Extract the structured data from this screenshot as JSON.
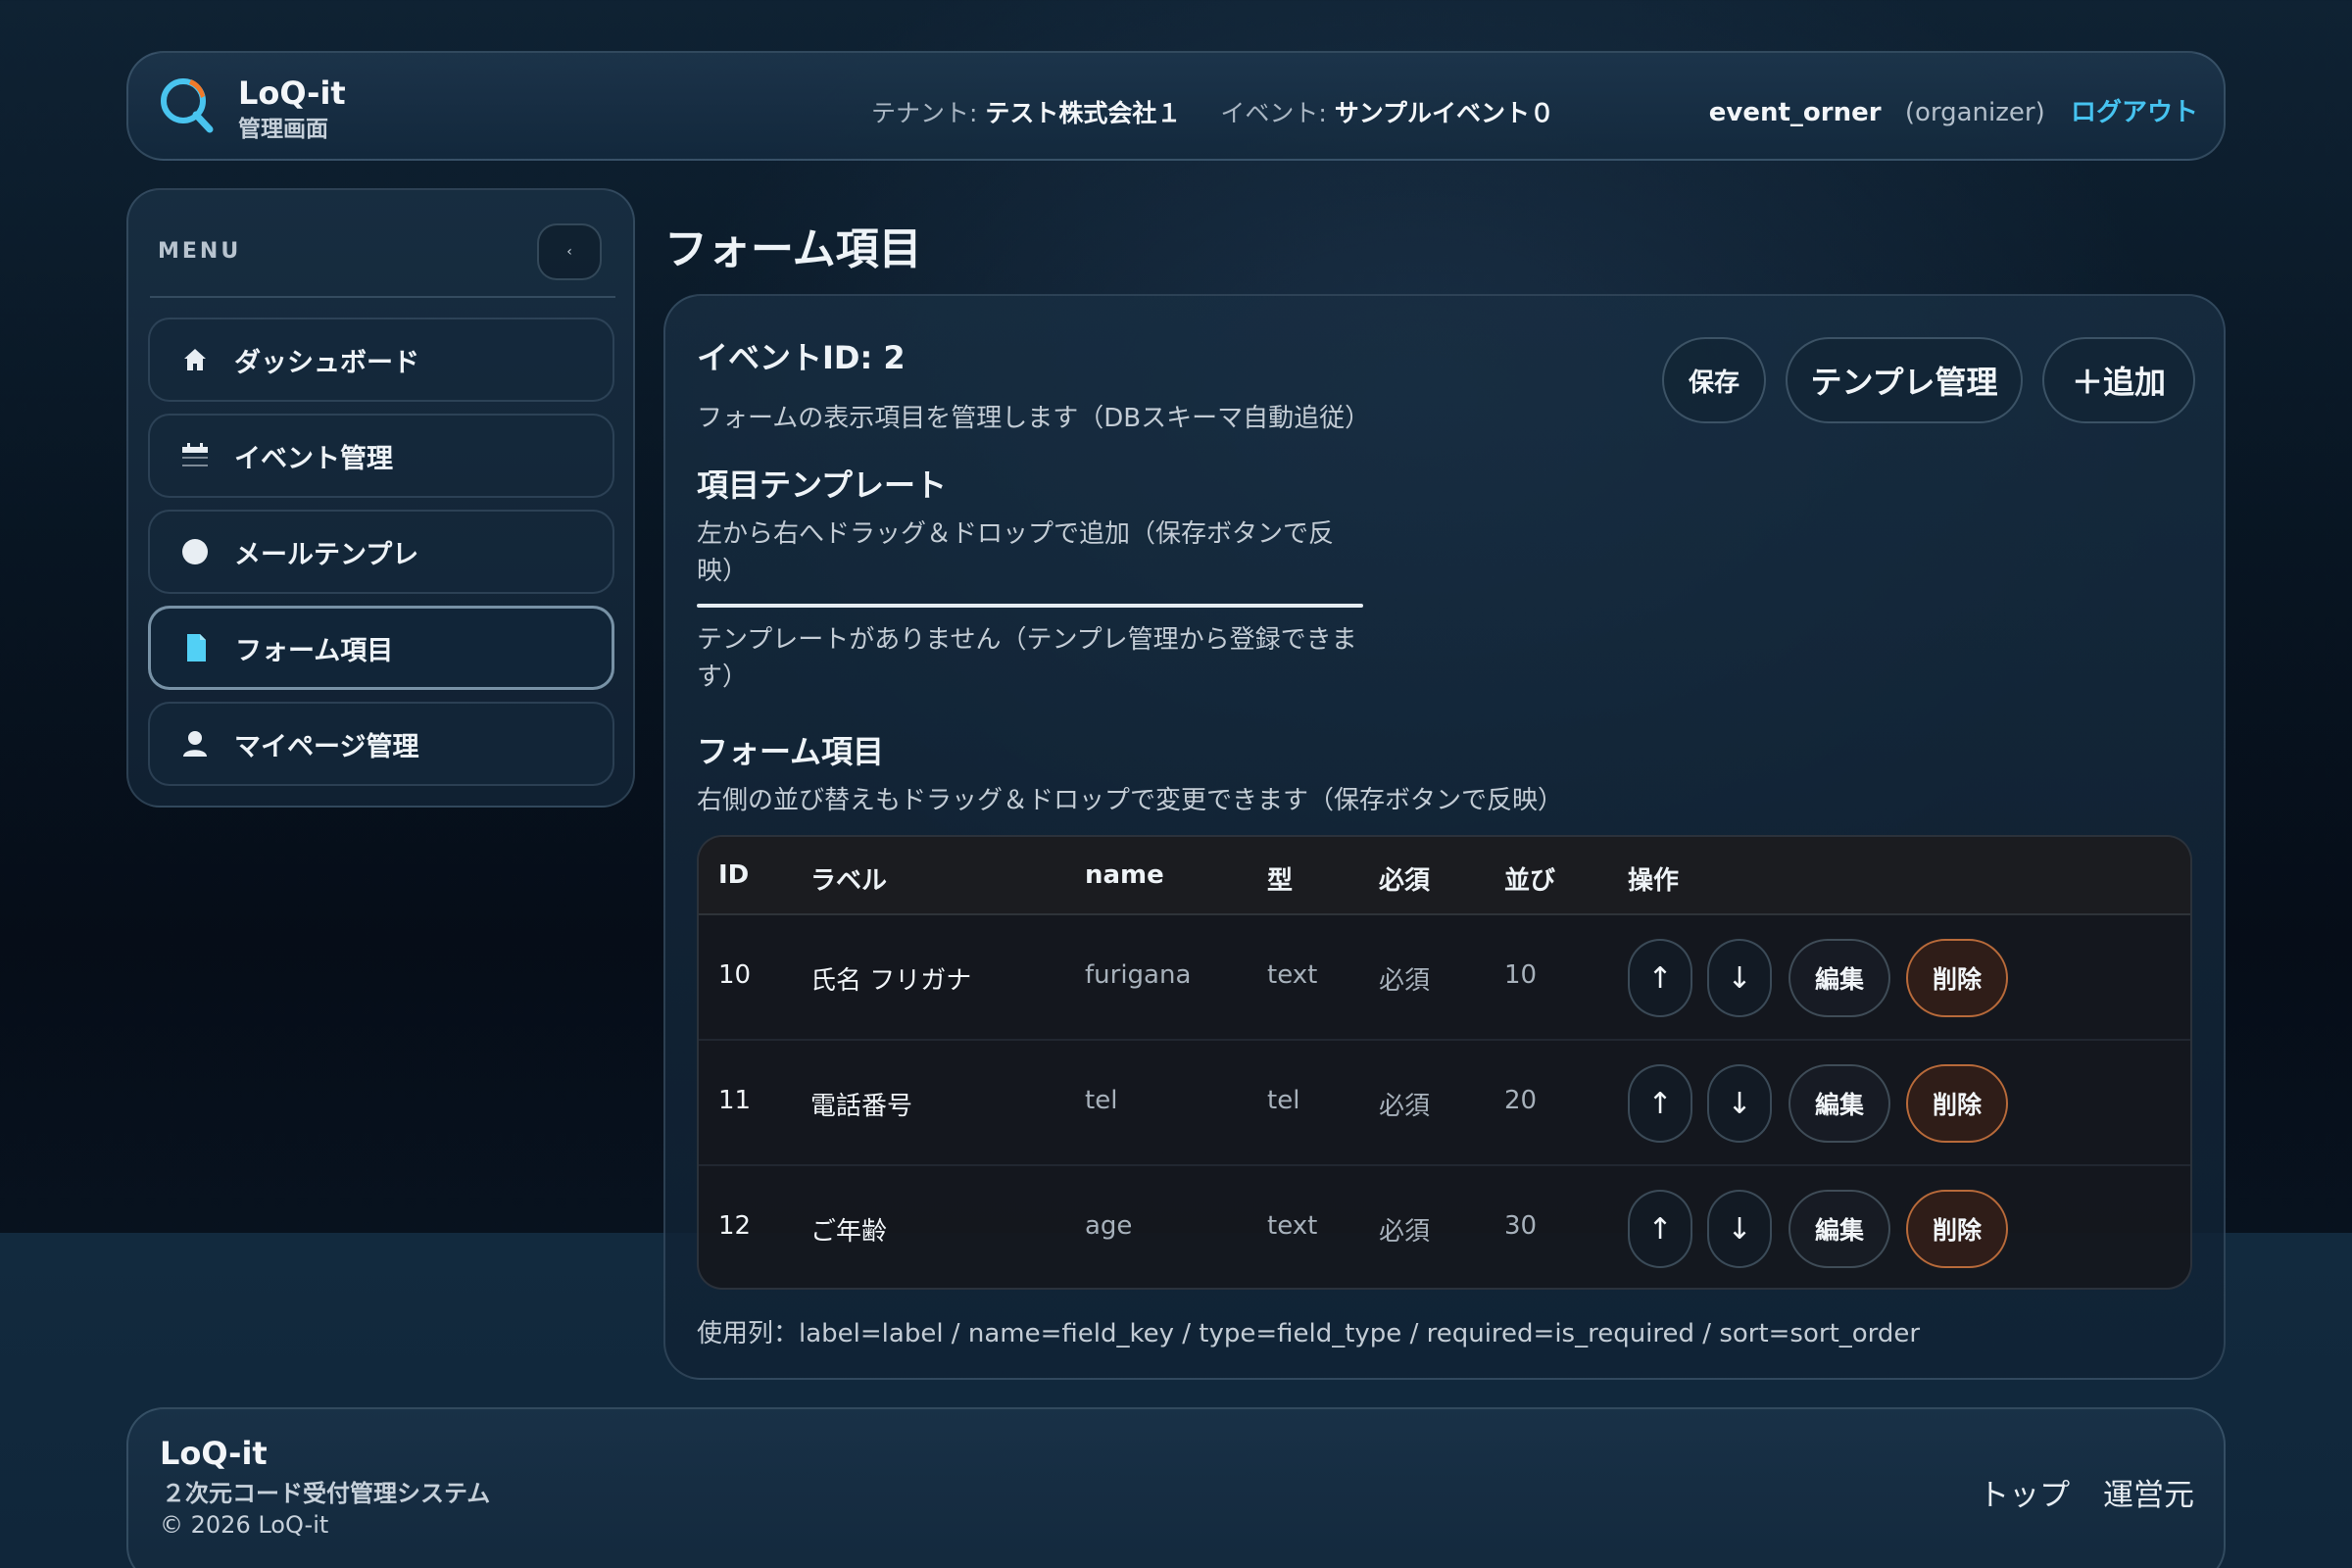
{
  "header": {
    "brand_name": "LoQ-it",
    "brand_sub": "管理画面",
    "tenant_key": "テナント:",
    "tenant_value": "テスト株式会社１",
    "event_key": "イベント:",
    "event_value": "サンプルイベント０",
    "user_name": "event_orner",
    "user_role": "(organizer)",
    "logout_label": "ログアウト"
  },
  "sidebar": {
    "menu_title": "MENU",
    "collapse_glyph": "‹",
    "items": [
      {
        "label": "ダッシュボード",
        "icon": "home-icon"
      },
      {
        "label": "イベント管理",
        "icon": "calendar-icon"
      },
      {
        "label": "メールテンプレ",
        "icon": "circle-icon"
      },
      {
        "label": "フォーム項目",
        "icon": "document-icon",
        "active": true
      },
      {
        "label": "マイページ管理",
        "icon": "user-icon"
      }
    ]
  },
  "main": {
    "page_title": "フォーム項目",
    "event_id": "イベントID: 2",
    "event_desc": "フォームの表示項目を管理します（DBスキーマ自動追従）",
    "buttons": {
      "save": "保存",
      "template_manage": "テンプレ管理",
      "add": "＋追加"
    },
    "template_section": {
      "title": "項目テンプレート",
      "note_line1": "左から右へドラッグ＆ドロップで追加（保存ボタンで反",
      "note_line2": "映）",
      "empty_line1": "テンプレートがありません（テンプレ管理から登録できま",
      "empty_line2": "す）"
    },
    "form_section": {
      "title": "フォーム項目",
      "note": "右側の並び替えもドラッグ＆ドロップで変更できます（保存ボタンで反映）"
    },
    "table": {
      "headers": {
        "id": "ID",
        "label": "ラベル",
        "name": "name",
        "type": "型",
        "required": "必須",
        "sort": "並び",
        "actions": "操作"
      },
      "rows": [
        {
          "id": "10",
          "label": "氏名 フリガナ",
          "name": "furigana",
          "type": "text",
          "required": "必須",
          "sort": "10"
        },
        {
          "id": "11",
          "label": "電話番号",
          "name": "tel",
          "type": "tel",
          "required": "必須",
          "sort": "20"
        },
        {
          "id": "12",
          "label": "ご年齢",
          "name": "age",
          "type": "text",
          "required": "必須",
          "sort": "30"
        }
      ],
      "up_glyph": "↑",
      "down_glyph": "↓",
      "edit_label": "編集",
      "delete_label": "削除"
    },
    "columns_note": "使用列：label=label / name=field_key / type=field_type / required=is_required / sort=sort_order"
  },
  "footer": {
    "brand": "LoQ-it",
    "subtitle": "２次元コード受付管理システム",
    "copyright": "© 2026 LoQ-it",
    "links": [
      "トップ",
      "運営元"
    ]
  },
  "colors": {
    "accent": "#46c3f0",
    "danger_border": "#b86a3a",
    "logo_orange": "#f07a2a"
  }
}
